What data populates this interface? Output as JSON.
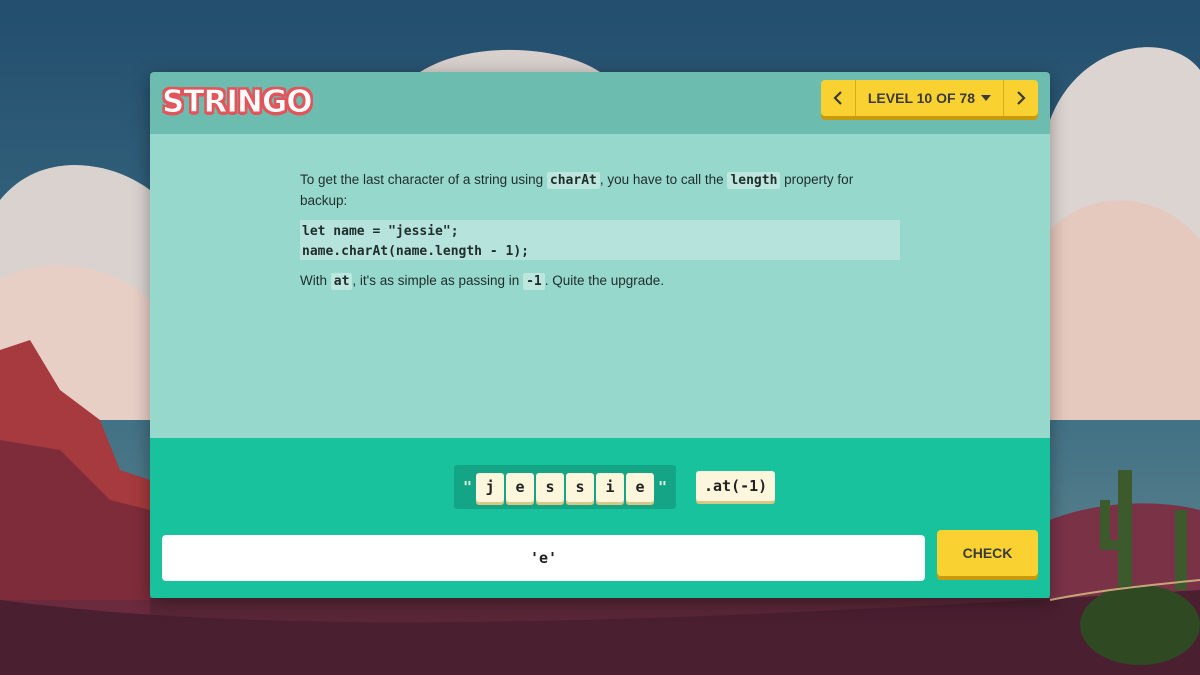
{
  "app": {
    "logo_text": "STRINGO"
  },
  "header": {
    "level_label": "LEVEL 10 OF 78",
    "prev_icon": "chevron-left-icon",
    "next_icon": "chevron-right-icon",
    "dropdown_icon": "caret-down-icon"
  },
  "lesson": {
    "p1": {
      "t1": "To get the last character of a string using ",
      "c1": "charAt",
      "t2": ", you have to call the ",
      "c2": "length",
      "t3": " property for backup:"
    },
    "code": {
      "line1": "let name = \"jessie\";",
      "line2": "name.charAt(name.length - 1);"
    },
    "p2": {
      "t1": "With ",
      "c1": "at",
      "t2": ", it's as simple as passing in ",
      "c2": "-1",
      "t3": ". Quite the upgrade."
    }
  },
  "puzzle": {
    "quote_open": "\"",
    "quote_close": "\"",
    "letters": [
      "j",
      "e",
      "s",
      "s",
      "i",
      "e"
    ],
    "method": ".at(-1)"
  },
  "answer": {
    "value": "'e'"
  },
  "check": {
    "label": "CHECK"
  },
  "colors": {
    "header_bg": "#6cbcb0",
    "body_bg": "#97d8cd",
    "footer_bg": "#17c29d",
    "button_yellow": "#f9d231",
    "logo_red": "#e2555a"
  }
}
